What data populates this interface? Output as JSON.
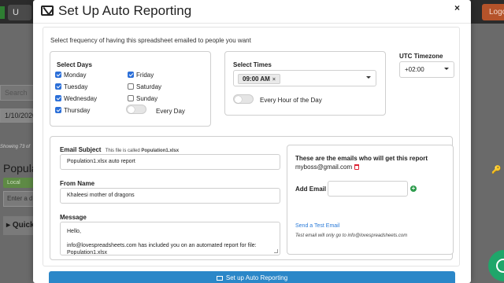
{
  "background": {
    "user_button_label": "U",
    "logout_label": "Logo",
    "search_placeholder": "Search",
    "date_value": "1/10/2020",
    "showing_text": "Showing 73 of",
    "sheet_title": "Popula",
    "local_button_label": "Local",
    "enter_placeholder": "Enter a d",
    "quick_label": "Quick"
  },
  "modal": {
    "title": "Set Up Auto Reporting",
    "close_label": "×",
    "intro": "Select frequency of having this spreadsheet emailed to people you want",
    "days": {
      "title": "Select Days",
      "items": [
        {
          "label": "Monday",
          "checked": true
        },
        {
          "label": "Tuesday",
          "checked": true
        },
        {
          "label": "Wednesday",
          "checked": true
        },
        {
          "label": "Thursday",
          "checked": true
        },
        {
          "label": "Friday",
          "checked": true
        },
        {
          "label": "Saturday",
          "checked": false
        },
        {
          "label": "Sunday",
          "checked": false
        }
      ],
      "every_day_label": "Every Day",
      "every_day_on": false
    },
    "times": {
      "title": "Select Times",
      "selected": "09:00 AM",
      "remove_symbol": "×",
      "every_hour_label": "Every Hour of the Day",
      "every_hour_on": false
    },
    "timezone": {
      "title": "UTC Timezone",
      "value": "+02:00"
    },
    "email": {
      "subject_label": "Email Subject",
      "file_note_prefix": "This file is called",
      "file_name": "Population1.xlsx",
      "subject_value": "Population1.xlsx auto report",
      "from_label": "From Name",
      "from_value": "Khaleesi mother of dragons",
      "message_label": "Message",
      "message_lines": [
        "Hello,",
        "info@lovespreadsheets.com has included you on an automated report for file: Population1.xlsx"
      ]
    },
    "recipients": {
      "title": "These are the emails who will get this report",
      "emails": [
        "myboss@gmail.com"
      ],
      "add_label": "Add Email",
      "add_value": "",
      "test_link": "Send a Test Email",
      "test_note": "Test email will only go to info@lovespreadsheets.com"
    },
    "submit_label": "Set up Auto Reporting"
  },
  "colors": {
    "accent": "#2b87c8",
    "checkbox": "#2b6fd8",
    "link": "#2b7bd8",
    "delete": "#dd2233",
    "add": "#2a9a4a"
  }
}
